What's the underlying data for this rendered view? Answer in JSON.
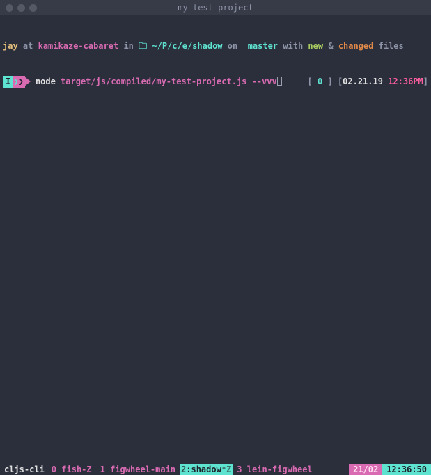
{
  "window": {
    "title": "my-test-project"
  },
  "prompt_line1": {
    "user": "jay",
    "at": "at",
    "host": "kamikaze-cabaret",
    "in": "in",
    "folder_icon": "🗀",
    "path": "~/P/c/e/shadow",
    "on": "on",
    "branch_icon": "",
    "branch": "master",
    "with": "with",
    "status_new": "new",
    "amp": "&",
    "status_changed": "changed",
    "files": "files"
  },
  "prompt_line2": {
    "mode": "I",
    "cmd_bin": "node",
    "cmd_args": "target/js/compiled/my-test-project.js --vvv",
    "rstatus": {
      "lbrack1": "[",
      "exit": "0",
      "rbrack1": "]",
      "lbrack2": "[",
      "date": "02.21.19",
      "time": "12:36PM",
      "rbrack2": "]"
    }
  },
  "statusbar": {
    "session": "cljs-cli",
    "windows": [
      {
        "index": "0",
        "name": "fish-Z",
        "active": false
      },
      {
        "index": "1",
        "name": "figwheel-main",
        "active": false
      },
      {
        "index": "2",
        "name": "shadow",
        "suffix": "*Z",
        "active": true
      },
      {
        "index": "3",
        "name": "lein-figwheel",
        "active": false
      }
    ],
    "date": "21/02",
    "time": "12:36:50"
  }
}
